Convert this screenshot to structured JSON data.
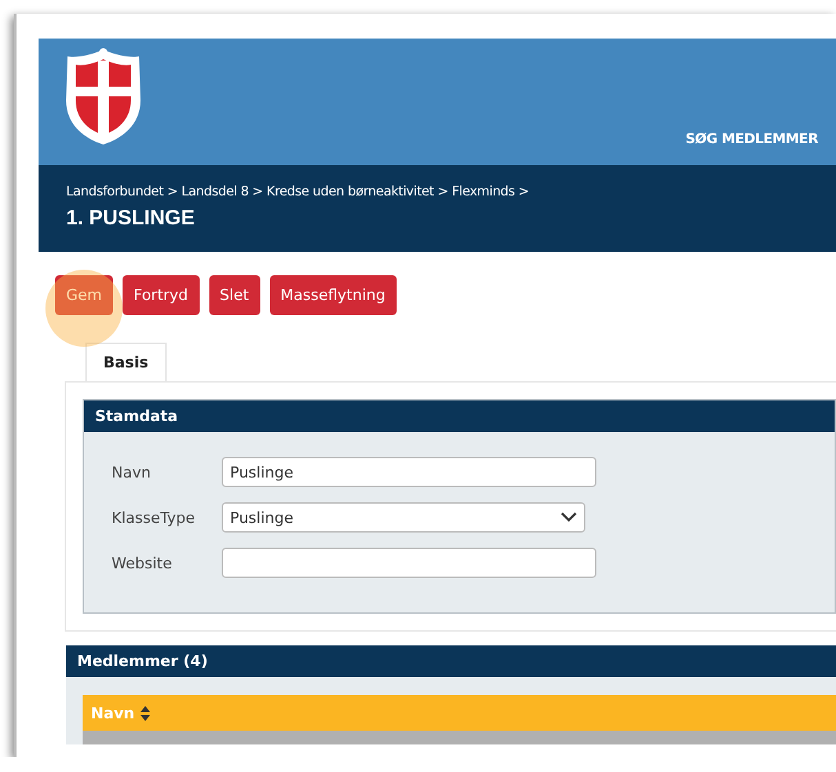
{
  "header": {
    "nav_link": "SØG MEDLEMMER"
  },
  "breadcrumb": "Landsforbundet > Landsdel 8 > Kredse uden børneaktivitet > Flexminds >",
  "title": "1. PUSLINGE",
  "buttons": [
    {
      "label": "Gem",
      "highlighted": true
    },
    {
      "label": "Fortryd",
      "highlighted": false
    },
    {
      "label": "Slet",
      "highlighted": false
    },
    {
      "label": "Masseflytning",
      "highlighted": false
    }
  ],
  "tabs": [
    {
      "label": "Basis",
      "selected": true
    }
  ],
  "stamdata": {
    "title": "Stamdata",
    "fields": [
      {
        "kind": "input",
        "label": "Navn",
        "value": "Puslinge"
      },
      {
        "kind": "select",
        "label": "KlasseType",
        "value": "Puslinge"
      },
      {
        "kind": "input",
        "label": "Website"
      }
    ]
  },
  "members": {
    "title": "Medlemmer (4)",
    "columns": [
      {
        "label": "Navn",
        "sortable": true
      }
    ]
  }
}
